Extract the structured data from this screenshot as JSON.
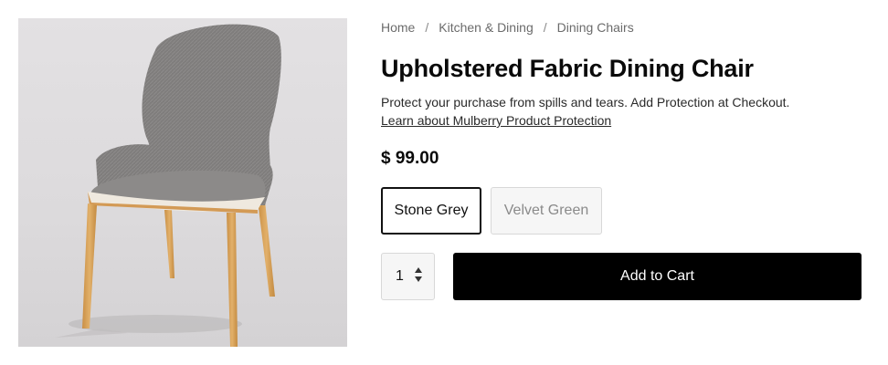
{
  "breadcrumb": {
    "items": [
      "Home",
      "Kitchen & Dining",
      "Dining Chairs"
    ],
    "separator": "/"
  },
  "product": {
    "title": "Upholstered Fabric Dining Chair",
    "protection_text": "Protect your purchase from spills and tears. Add Protection at Checkout.",
    "protection_link": "Learn about Mulberry Product Protection",
    "price": "$ 99.00",
    "image_icon": "chair-photo"
  },
  "variants": [
    {
      "label": "Stone Grey",
      "selected": true
    },
    {
      "label": "Velvet Green",
      "selected": false
    }
  ],
  "quantity": {
    "value": "1"
  },
  "cart": {
    "button_label": "Add to Cart"
  },
  "colors": {
    "button_bg": "#000000",
    "text": "#111111",
    "muted": "#6b6b6b",
    "image_bg": "#dcdadc"
  }
}
